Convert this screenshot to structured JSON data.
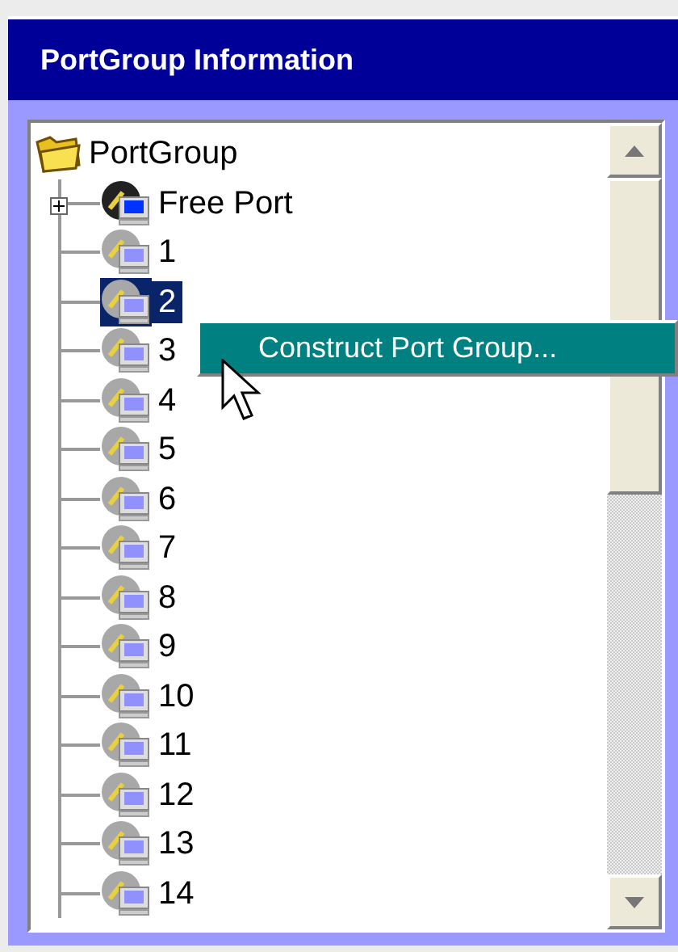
{
  "window": {
    "title": "PortGroup Information"
  },
  "tree": {
    "label": "PortGroup",
    "kind": "folder",
    "expanded": true,
    "children": [
      {
        "label": "Free Port",
        "kind": "free",
        "expanded": false,
        "selected": false
      },
      {
        "label": "1",
        "kind": "port",
        "selected": false
      },
      {
        "label": "2",
        "kind": "port",
        "selected": true
      },
      {
        "label": "3",
        "kind": "port",
        "selected": false
      },
      {
        "label": "4",
        "kind": "port",
        "selected": false
      },
      {
        "label": "5",
        "kind": "port",
        "selected": false
      },
      {
        "label": "6",
        "kind": "port",
        "selected": false
      },
      {
        "label": "7",
        "kind": "port",
        "selected": false
      },
      {
        "label": "8",
        "kind": "port",
        "selected": false
      },
      {
        "label": "9",
        "kind": "port",
        "selected": false
      },
      {
        "label": "10",
        "kind": "port",
        "selected": false
      },
      {
        "label": "11",
        "kind": "port",
        "selected": false
      },
      {
        "label": "12",
        "kind": "port",
        "selected": false
      },
      {
        "label": "13",
        "kind": "port",
        "selected": false
      },
      {
        "label": "14",
        "kind": "port",
        "selected": false
      }
    ]
  },
  "context_menu": {
    "items": [
      "Construct Port Group..."
    ]
  }
}
